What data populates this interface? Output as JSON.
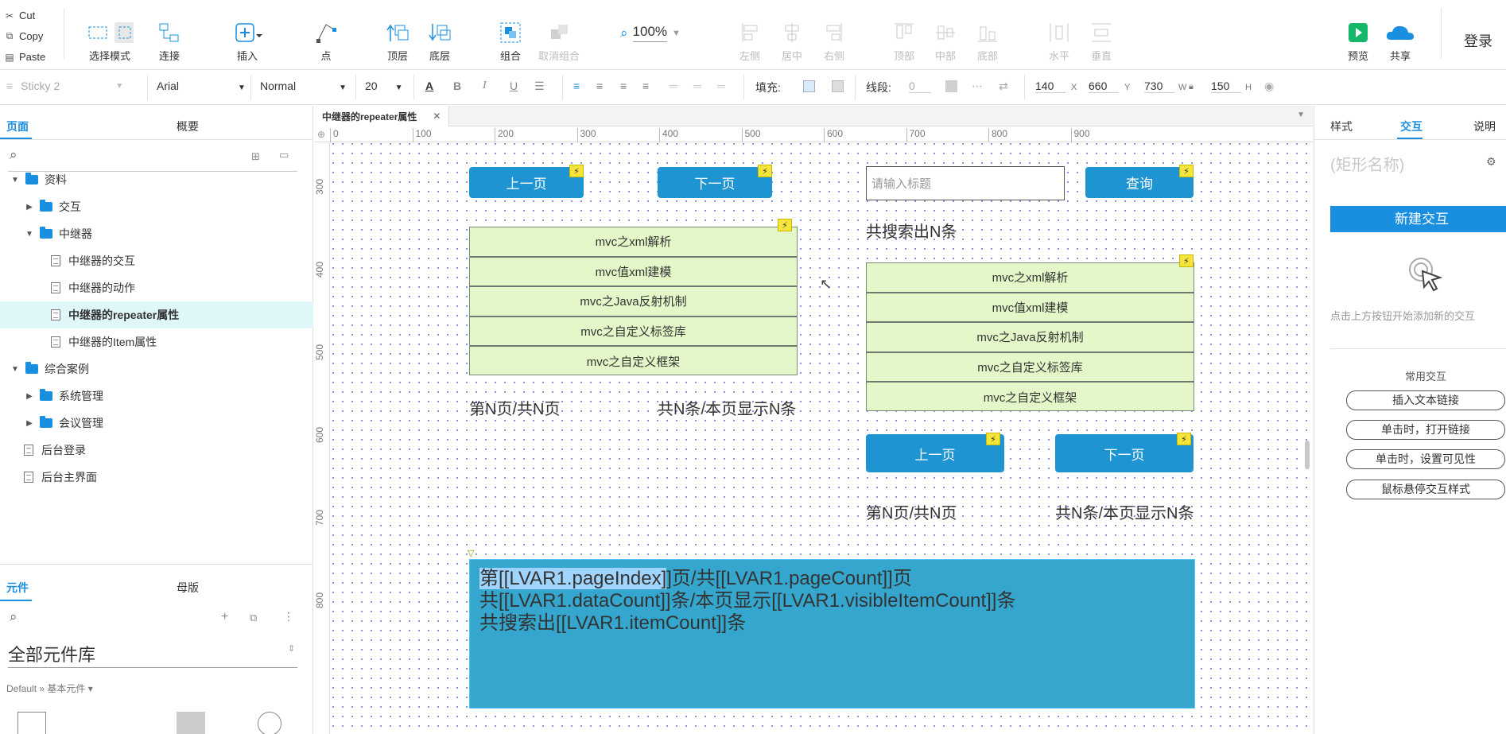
{
  "clipboard": {
    "cut": "Cut",
    "copy": "Copy",
    "paste": "Paste"
  },
  "toolbar": {
    "select_mode": "选择模式",
    "connect": "连接",
    "insert": "插入",
    "point": "点",
    "top": "顶层",
    "bottom": "底层",
    "group": "组合",
    "ungroup": "取消组合",
    "zoom": "100%",
    "left": "左侧",
    "center": "居中",
    "right": "右侧",
    "top_align": "顶部",
    "middle": "中部",
    "bottom_align": "底部",
    "horizontal": "水平",
    "vertical": "垂直",
    "preview": "预览",
    "share": "共享",
    "login": "登录"
  },
  "format": {
    "style_name": "Sticky 2",
    "font": "Arial",
    "weight": "Normal",
    "size": "20",
    "fill_label": "填充:",
    "stroke_label": "线段:",
    "stroke_value": "0",
    "x": "140",
    "x_unit": "X",
    "y": "660",
    "y_unit": "Y",
    "w": "730",
    "w_unit": "W",
    "h": "150",
    "h_unit": "H"
  },
  "left_panel": {
    "tab_pages": "页面",
    "tab_outline": "概要",
    "tree": [
      {
        "label": "资料",
        "kind": "folder",
        "level": 0,
        "arrow": "▼"
      },
      {
        "label": "交互",
        "kind": "folder",
        "level": 1,
        "arrow": "▶"
      },
      {
        "label": "中继器",
        "kind": "folder",
        "level": 1,
        "arrow": "▼"
      },
      {
        "label": "中继器的交互",
        "kind": "page",
        "level": 2
      },
      {
        "label": "中继器的动作",
        "kind": "page",
        "level": 2
      },
      {
        "label": "中继器的repeater属性",
        "kind": "page",
        "level": 2,
        "selected": true
      },
      {
        "label": "中继器的Item属性",
        "kind": "page",
        "level": 2
      },
      {
        "label": "综合案例",
        "kind": "folder",
        "level": 0,
        "arrow": "▼"
      },
      {
        "label": "系统管理",
        "kind": "folder",
        "level": 1,
        "arrow": "▶"
      },
      {
        "label": "会议管理",
        "kind": "folder",
        "level": 1,
        "arrow": "▶"
      },
      {
        "label": "后台登录",
        "kind": "page",
        "level": 1
      },
      {
        "label": "后台主界面",
        "kind": "page",
        "level": 1
      }
    ],
    "tab_widgets": "元件",
    "tab_masters": "母版",
    "library_title": "全部元件库",
    "library_path": "Default » 基本元件 ▾"
  },
  "document_tab": "中继器的repeater属性",
  "ruler_h": [
    "0",
    "100",
    "200",
    "300",
    "400",
    "500",
    "600",
    "700",
    "800",
    "900"
  ],
  "ruler_v": [
    "300",
    "400",
    "500",
    "600",
    "700",
    "800"
  ],
  "canvas": {
    "prev_label": "上一页",
    "next_label": "下一页",
    "query_label": "查询",
    "search_placeholder": "请输入标题",
    "search_count": "共搜索出N条",
    "rows": [
      "mvc之xml解析",
      "mvc值xml建模",
      "mvc之Java反射机制",
      "mvc之自定义标签库",
      "mvc之自定义框架"
    ],
    "page_info": "第N页/共N页",
    "count_info": "共N条/本页显示N条",
    "big_text_highlight": "第[[LVAR1.pageIndex]",
    "big_text_line1_rest": "]页/共[[LVAR1.pageCount]]页",
    "big_text_line2": "共[[LVAR1.dataCount]]条/本页显示[[LVAR1.visibleItemCount]]条",
    "big_text_line3": "共搜索出[[LVAR1.itemCount]]条"
  },
  "right_panel": {
    "tab_style": "样式",
    "tab_interaction": "交互",
    "tab_notes": "说明",
    "shape_name_placeholder": "(矩形名称)",
    "new_interaction": "新建交互",
    "hint": "点击上方按钮开始添加新的交互",
    "common_title": "常用交互",
    "common": [
      "插入文本链接",
      "单击时，打开链接",
      "单击时，设置可见性",
      "鼠标悬停交互样式"
    ]
  },
  "accent": "#1f94d2"
}
